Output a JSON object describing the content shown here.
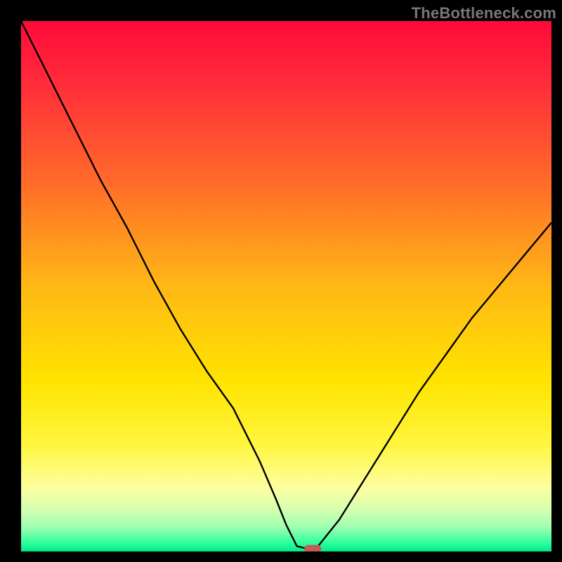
{
  "watermark": "TheBottleneck.com",
  "chart_data": {
    "type": "line",
    "title": "",
    "xlabel": "",
    "ylabel": "",
    "xlim": [
      0,
      100
    ],
    "ylim": [
      0,
      100
    ],
    "x": [
      0,
      5,
      10,
      15,
      20,
      22,
      25,
      30,
      35,
      40,
      45,
      48,
      50,
      52,
      54,
      55,
      56,
      60,
      65,
      70,
      75,
      80,
      85,
      90,
      95,
      100
    ],
    "values": [
      100,
      90,
      80,
      70,
      61,
      57,
      51,
      42,
      34,
      27,
      17,
      10,
      5,
      1,
      0.5,
      0.5,
      1,
      6,
      14,
      22,
      30,
      37,
      44,
      50,
      56,
      62
    ],
    "minimum_marker": {
      "x": 55,
      "y": 0.5
    },
    "gradient_stops": [
      {
        "offset": 0,
        "color": "#ff0a3a"
      },
      {
        "offset": 0.12,
        "color": "#ff2d3a"
      },
      {
        "offset": 0.3,
        "color": "#ff6a2a"
      },
      {
        "offset": 0.5,
        "color": "#ffb815"
      },
      {
        "offset": 0.68,
        "color": "#ffe400"
      },
      {
        "offset": 0.8,
        "color": "#fff640"
      },
      {
        "offset": 0.88,
        "color": "#fdffa0"
      },
      {
        "offset": 0.92,
        "color": "#d6ffb0"
      },
      {
        "offset": 0.955,
        "color": "#9dffb0"
      },
      {
        "offset": 0.985,
        "color": "#2bff9c"
      },
      {
        "offset": 1.0,
        "color": "#00e886"
      }
    ],
    "marker_color": "#c55a57",
    "curve_color": "#000000"
  }
}
